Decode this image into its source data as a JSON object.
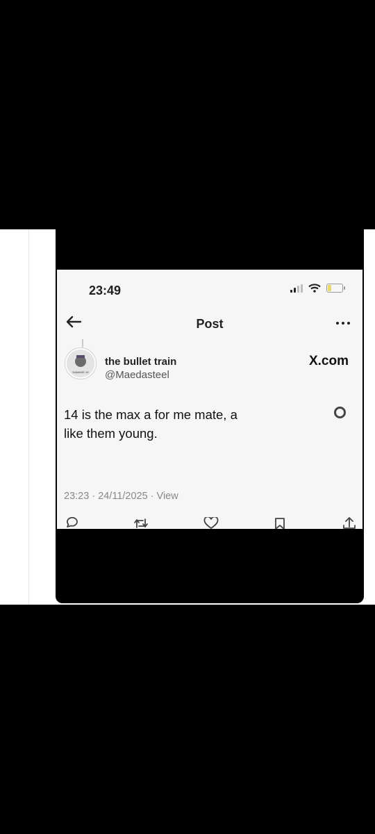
{
  "status_bar": {
    "time": "23:49"
  },
  "nav": {
    "title": "Post"
  },
  "author": {
    "display_name": "the bullet train",
    "handle": "@Maedasteel",
    "avatar_text": "DAMAGE 10"
  },
  "brand": "X.com",
  "tweet": {
    "text_line1": "14 is the max a for me mate,  a",
    "text_line2": "like them young.",
    "meta": "23:23 · 24/11/2025 · View"
  },
  "icons": {
    "back": "back-arrow-icon",
    "more": "more-icon",
    "reply": "reply-icon",
    "retweet": "retweet-icon",
    "like": "like-icon",
    "bookmark": "bookmark-icon",
    "share": "share-icon"
  },
  "colors": {
    "background": "#000000",
    "band": "#ffffff",
    "screenshot_bg": "#f6f6f6",
    "battery": "#e8d86a"
  },
  "battery_level": 0.3
}
